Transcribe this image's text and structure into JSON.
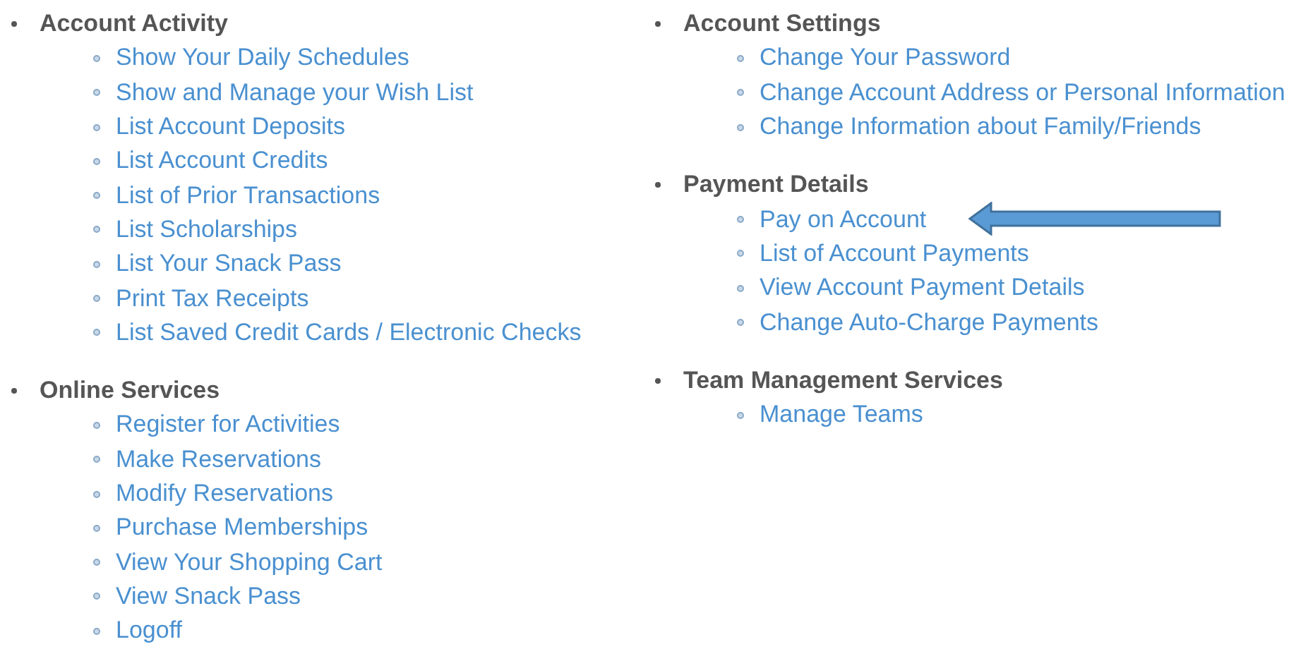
{
  "columns": [
    {
      "sections": [
        {
          "heading": "Account Activity",
          "links": [
            {
              "label": "Show Your Daily Schedules",
              "marked": false
            },
            {
              "label": "Show and Manage your Wish List",
              "marked": false
            },
            {
              "label": "List Account Deposits",
              "marked": false
            },
            {
              "label": "List Account Credits",
              "marked": false
            },
            {
              "label": "List of Prior Transactions",
              "marked": false
            },
            {
              "label": "List Scholarships",
              "marked": false
            },
            {
              "label": "List Your Snack Pass",
              "marked": false
            },
            {
              "label": "Print Tax Receipts",
              "marked": false
            },
            {
              "label": "List Saved Credit Cards / Electronic Checks",
              "marked": false
            }
          ]
        },
        {
          "heading": "Online Services",
          "links": [
            {
              "label": "Register for Activities",
              "marked": false
            },
            {
              "label": "Make Reservations",
              "marked": false
            },
            {
              "label": "Modify Reservations",
              "marked": false
            },
            {
              "label": "Purchase Memberships",
              "marked": false
            },
            {
              "label": "View Your Shopping Cart",
              "marked": false
            },
            {
              "label": "View Snack Pass",
              "marked": false
            },
            {
              "label": "Logoff",
              "marked": false
            }
          ]
        }
      ]
    },
    {
      "sections": [
        {
          "heading": "Account Settings",
          "links": [
            {
              "label": "Change Your Password",
              "marked": false
            },
            {
              "label": "Change Account Address or Personal Information",
              "marked": false
            },
            {
              "label": "Change Information about Family/Friends",
              "marked": false
            }
          ]
        },
        {
          "heading": "Payment Details",
          "links": [
            {
              "label": "Pay on Account",
              "marked": true
            },
            {
              "label": "List of Account Payments",
              "marked": false
            },
            {
              "label": "View Account Payment Details",
              "marked": false
            },
            {
              "label": "Change Auto-Charge Payments",
              "marked": false
            }
          ]
        },
        {
          "heading": "Team Management Services",
          "links": [
            {
              "label": "Manage Teams",
              "marked": false
            }
          ]
        }
      ]
    }
  ]
}
